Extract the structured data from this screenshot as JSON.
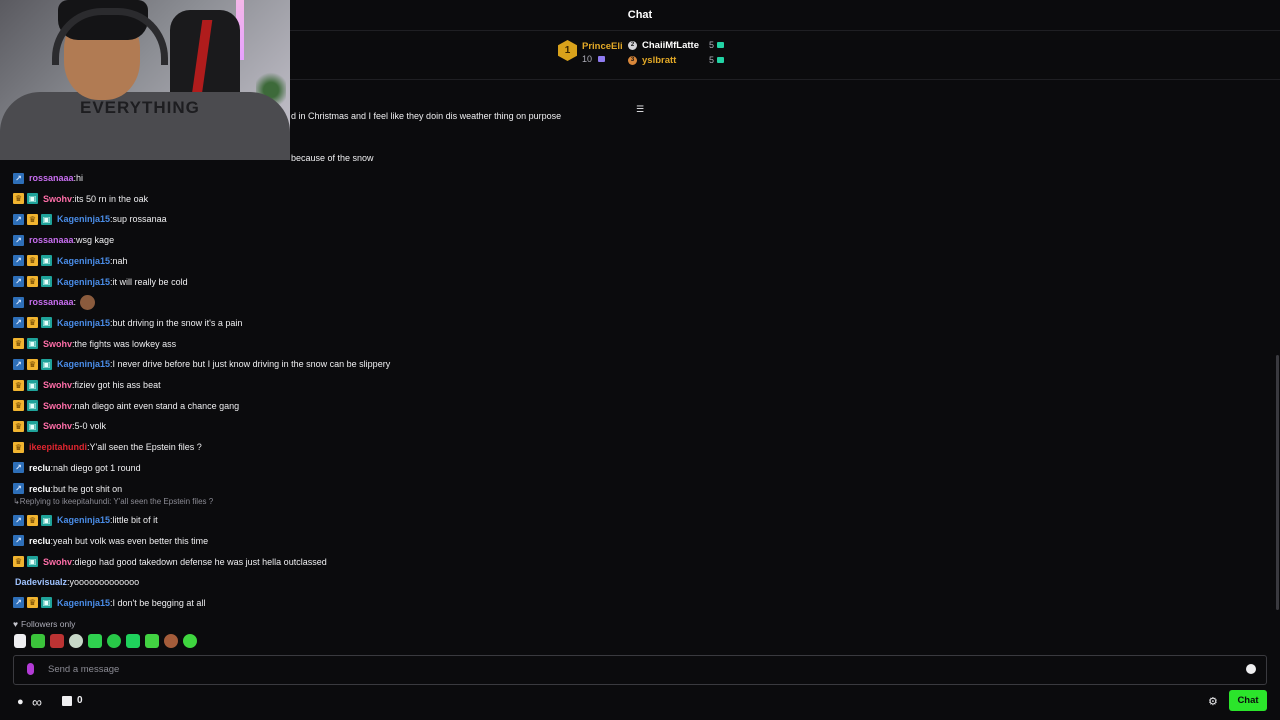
{
  "header": {
    "title": "Chat"
  },
  "leaderboard": {
    "first": {
      "rank": "1",
      "name": "PrinceEli",
      "count": "10"
    },
    "others": [
      {
        "name": "ChaiiMfLatte",
        "count": "5",
        "color": "#ffffff"
      },
      {
        "name": "yslbratt",
        "count": "5",
        "color": "#e3a927"
      }
    ]
  },
  "partial_lines": [
    "d in Christmas and I feel like they doin dis weather thing on purpose",
    "because of the snow"
  ],
  "messages": [
    {
      "badges": [
        "arrow"
      ],
      "user": "rossanaaa",
      "color": "#c86ef0",
      "text": "hi"
    },
    {
      "badges": [
        "crown",
        "sub"
      ],
      "user": "Swohv",
      "color": "#ff6ea8",
      "text": "its 50 rn in the oak"
    },
    {
      "badges": [
        "arrow",
        "crown",
        "sub"
      ],
      "user": "Kageninja15",
      "color": "#4a8de8",
      "text": "sup rossanaa"
    },
    {
      "badges": [
        "arrow"
      ],
      "user": "rossanaaa",
      "color": "#c86ef0",
      "text": "wsg kage"
    },
    {
      "badges": [
        "arrow",
        "crown",
        "sub"
      ],
      "user": "Kageninja15",
      "color": "#4a8de8",
      "text": "nah"
    },
    {
      "badges": [
        "arrow",
        "crown",
        "sub"
      ],
      "user": "Kageninja15",
      "color": "#4a8de8",
      "text": "it will really be cold"
    },
    {
      "badges": [
        "arrow"
      ],
      "user": "rossanaaa",
      "color": "#c86ef0",
      "text": "",
      "emote": true
    },
    {
      "badges": [
        "arrow",
        "crown",
        "sub"
      ],
      "user": "Kageninja15",
      "color": "#4a8de8",
      "text": "but driving in the snow it's a pain"
    },
    {
      "badges": [
        "crown",
        "sub"
      ],
      "user": "Swohv",
      "color": "#ff6ea8",
      "text": "the fights was lowkey ass"
    },
    {
      "badges": [
        "arrow",
        "crown",
        "sub"
      ],
      "user": "Kageninja15",
      "color": "#4a8de8",
      "text": "I never drive before but I just know driving in the snow can be slippery"
    },
    {
      "badges": [
        "crown",
        "sub"
      ],
      "user": "Swohv",
      "color": "#ff6ea8",
      "text": "fiziev got his ass beat"
    },
    {
      "badges": [
        "crown",
        "sub"
      ],
      "user": "Swohv",
      "color": "#ff6ea8",
      "text": "nah diego aint even stand a chance gang"
    },
    {
      "badges": [
        "crown",
        "sub"
      ],
      "user": "Swohv",
      "color": "#ff6ea8",
      "text": "5-0 volk"
    },
    {
      "badges": [
        "crown"
      ],
      "user": "ikeepitahundi",
      "color": "#e0262f",
      "text": "Y'all seen the Epstein files ?"
    },
    {
      "badges": [
        "arrow"
      ],
      "user": "reclu",
      "color": "#ffffff",
      "text": "nah diego got 1 round"
    },
    {
      "badges": [
        "arrow"
      ],
      "user": "reclu",
      "color": "#ffffff",
      "text": "but he got shit on"
    },
    {
      "badges": [
        "arrow",
        "crown",
        "sub"
      ],
      "user": "Kageninja15",
      "color": "#4a8de8",
      "text": "little bit of it",
      "reply": "Replying to ikeepitahundi: Y'all seen the Epstein files ?"
    },
    {
      "badges": [
        "arrow"
      ],
      "user": "reclu",
      "color": "#ffffff",
      "text": "yeah but volk was even better this time"
    },
    {
      "badges": [
        "crown",
        "sub"
      ],
      "user": "Swohv",
      "color": "#ff6ea8",
      "text": "diego had good takedown defense he was just hella outclassed"
    },
    {
      "badges": [],
      "user": "Dadevisualz",
      "color": "#9fc3ff",
      "text": "yooooooooooooo"
    },
    {
      "badges": [
        "arrow",
        "crown",
        "sub"
      ],
      "user": "Kageninja15",
      "color": "#4a8de8",
      "text": "I don't be begging at all"
    }
  ],
  "followers_only": "Followers only",
  "input": {
    "placeholder": "Send a message"
  },
  "bottom": {
    "gift_count": "0",
    "chat_button": "Chat"
  },
  "colors": {
    "accent": "#2be52b",
    "background": "#0b0b0d"
  },
  "icons": [
    "mic-icon",
    "emoji-icon",
    "gear-icon",
    "gift-icon",
    "bits-icon",
    "infinity-icon",
    "heart-icon",
    "collapse-icon"
  ]
}
